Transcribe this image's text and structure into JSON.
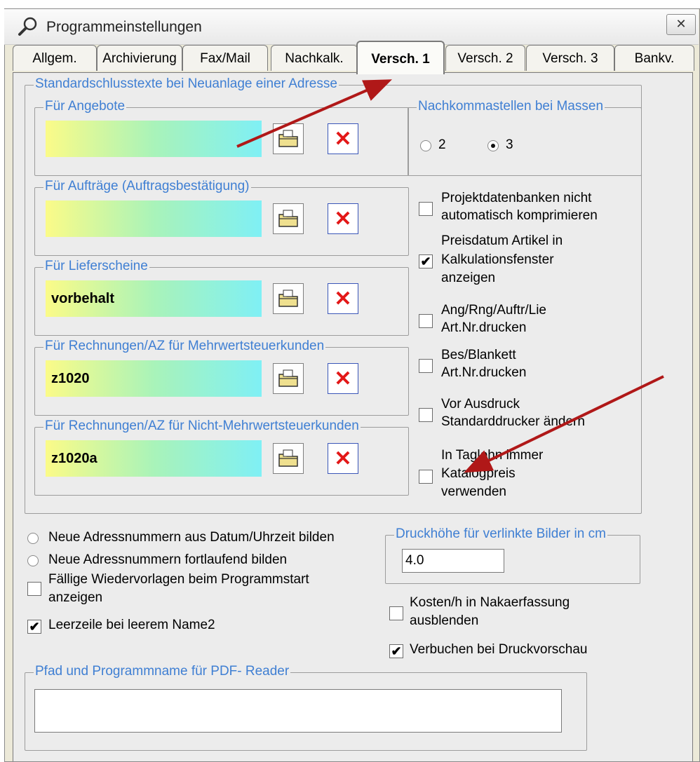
{
  "window": {
    "title": "Programmeinstellungen",
    "close_label": "✕"
  },
  "tabs": [
    {
      "label": "Allgem."
    },
    {
      "label": "Archivierung"
    },
    {
      "label": "Fax/Mail"
    },
    {
      "label": "Nachkalk."
    },
    {
      "label": "Versch. 1",
      "active": true
    },
    {
      "label": "Versch. 2"
    },
    {
      "label": "Versch. 3"
    },
    {
      "label": "Bankv."
    }
  ],
  "std_texts": {
    "group_label": "Standardschlusstexte bei Neuanlage einer Adresse",
    "items": [
      {
        "label": "Für Angebote",
        "value": ""
      },
      {
        "label": "Für Aufträge (Auftragsbestätigung)",
        "value": ""
      },
      {
        "label": "Für Lieferscheine",
        "value": "vorbehalt"
      },
      {
        "label": "Für Rechnungen/AZ für Mehrwertsteuerkunden",
        "value": "z1020"
      },
      {
        "label": "Für Rechnungen/AZ für Nicht-Mehrwertsteuerkunden",
        "value": "z1020a"
      }
    ],
    "delete_glyph": "✕"
  },
  "nachkomma": {
    "label": "Nachkommastellen bei Massen",
    "option1": "2",
    "option2": "3",
    "selected": "3"
  },
  "options": [
    {
      "line1": "Projektdatenbanken nicht",
      "line2": "automatisch komprimieren",
      "line3": "",
      "checked": false
    },
    {
      "line1": "Preisdatum Artikel in",
      "line2": "Kalkulationsfenster",
      "line3": "anzeigen",
      "checked": true
    },
    {
      "line1": "Ang/Rng/Auftr/Lie",
      "line2": "Art.Nr.drucken",
      "line3": "",
      "checked": false
    },
    {
      "line1": "Bes/Blankett",
      "line2": "Art.Nr.drucken",
      "line3": "",
      "checked": false
    },
    {
      "line1": "Vor Ausdruck",
      "line2": "Standarddrucker ändern",
      "line3": "",
      "checked": false
    },
    {
      "line1": "In Taglohn immer",
      "line2": "Katalogpreis",
      "line3": "verwenden",
      "checked": false
    }
  ],
  "address": {
    "radio1": "Neue Adressnummern aus Datum/Uhrzeit bilden",
    "radio2": "Neue Adressnummern fortlaufend bilden"
  },
  "wiedervorlagen": {
    "line1": "Fällige Wiedervorlagen beim Programmstart",
    "line2": "anzeigen",
    "checked": false
  },
  "leerzeile": {
    "label": "Leerzeile bei leerem Name2",
    "checked": true
  },
  "druckhoehe": {
    "label": "Druckhöhe für verlinkte Bilder in cm",
    "value": "4.0"
  },
  "kosten": {
    "line1": "Kosten/h in Nakaerfassung",
    "line2": "ausblenden",
    "checked": false
  },
  "verbuchen": {
    "label": "Verbuchen bei Druckvorschau",
    "checked": true
  },
  "pdf": {
    "label": "Pfad und Programmname für PDF- Reader",
    "value": ""
  },
  "colors": {
    "group_label": "#3f7fd3",
    "delete_icon": "#e31818",
    "arrow": "#b01818"
  },
  "check_glyph": "✔"
}
